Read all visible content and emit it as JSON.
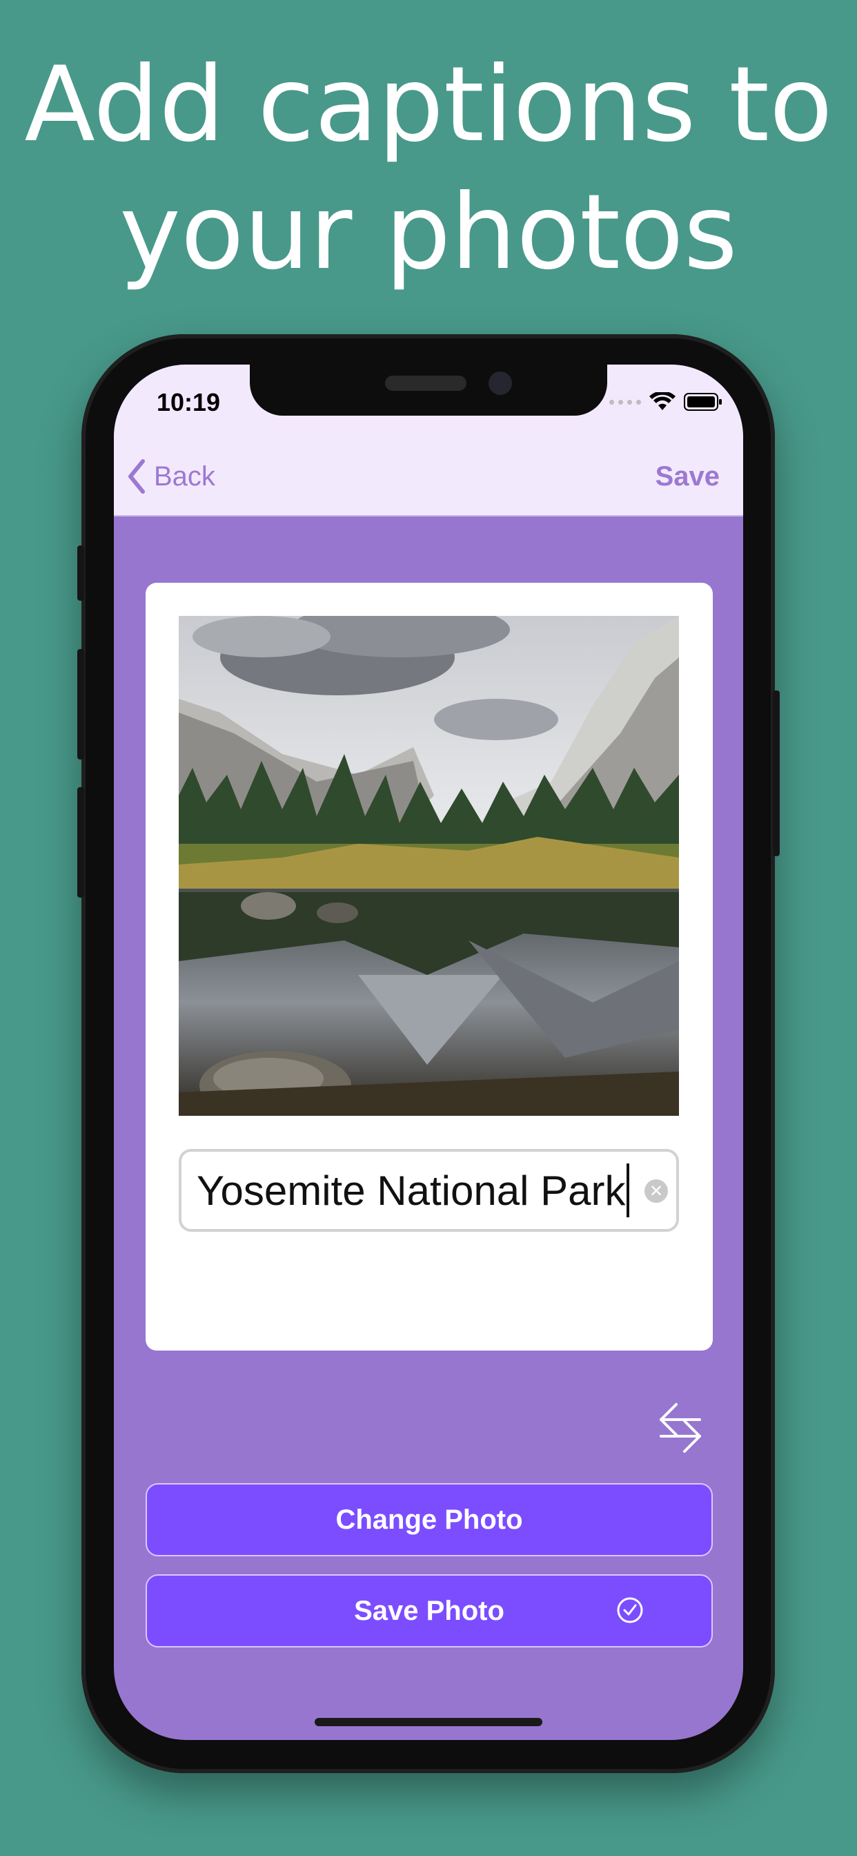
{
  "promo": {
    "headline_line1": "Add captions to",
    "headline_line2": "your photos"
  },
  "status_bar": {
    "time": "10:19",
    "icons": [
      "signal-dots-icon",
      "wifi-icon",
      "battery-icon"
    ]
  },
  "nav": {
    "back_label": "Back",
    "save_label": "Save"
  },
  "photo": {
    "subject": "mountain-lake-reflection"
  },
  "caption_field": {
    "value": "Yosemite National Park"
  },
  "actions": {
    "change_photo_label": "Change Photo",
    "save_photo_label": "Save Photo"
  },
  "colors": {
    "background": "#48998a",
    "nav_bar": "#f3e9fc",
    "screen_bg": "#9776d0",
    "accent": "#9b79d2",
    "button": "#7c4dff"
  }
}
